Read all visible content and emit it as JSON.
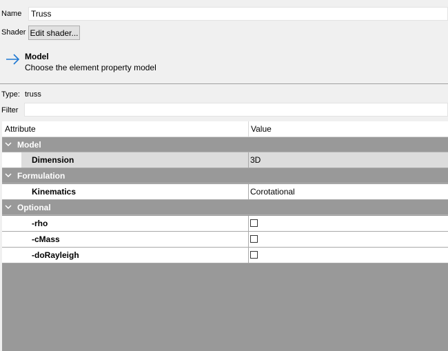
{
  "name_field": {
    "label": "Name",
    "value": "Truss"
  },
  "shader": {
    "label": "Shader",
    "button": "Edit shader..."
  },
  "header": {
    "title": "Model",
    "subtitle": "Choose the element property model",
    "icon": "arrow-right-icon"
  },
  "type": {
    "label": "Type:",
    "value": "truss"
  },
  "filter": {
    "label": "Filter",
    "value": "",
    "placeholder": ""
  },
  "table": {
    "columns": [
      "Attribute",
      "Value"
    ],
    "groups": [
      {
        "label": "Model",
        "rows": [
          {
            "name": "Dimension",
            "value": "3D"
          }
        ]
      },
      {
        "label": "Formulation",
        "rows": [
          {
            "name": "Kinematics",
            "value": "Corotational"
          }
        ]
      },
      {
        "label": "Optional",
        "rows": [
          {
            "name": "-rho",
            "checked": false
          },
          {
            "name": "-cMass",
            "checked": false
          },
          {
            "name": "-doRayleigh",
            "checked": false
          }
        ]
      }
    ]
  },
  "colors": {
    "accent": "#1e78d2",
    "group_bg": "#999999",
    "selected_row": "#dcdcdc"
  }
}
